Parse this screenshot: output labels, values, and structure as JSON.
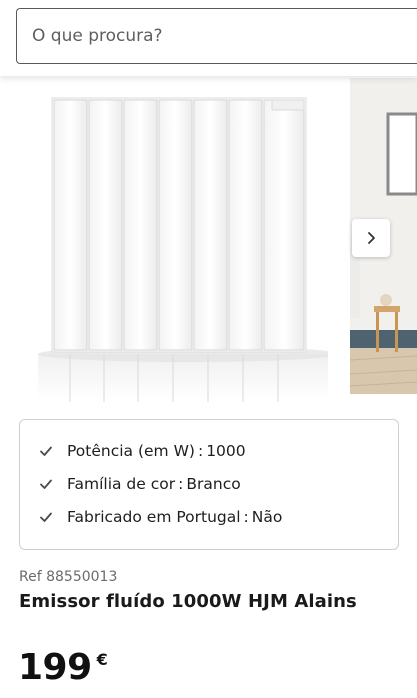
{
  "search": {
    "placeholder": "O que procura?"
  },
  "gallery": {
    "next_icon": "chevron-right-icon"
  },
  "specs": [
    {
      "label": "Potência (em W)",
      "value": "1000"
    },
    {
      "label": "Família de cor",
      "value": "Branco"
    },
    {
      "label": "Fabricado em Portugal",
      "value": "Não"
    }
  ],
  "product": {
    "ref": "Ref 88550013",
    "title": "Emissor fluído 1000W HJM Alains",
    "price": "199",
    "currency": "€"
  },
  "colors": {
    "text": "#1a1a1a",
    "muted": "#6b6b6b",
    "border": "#cfcfcf"
  }
}
